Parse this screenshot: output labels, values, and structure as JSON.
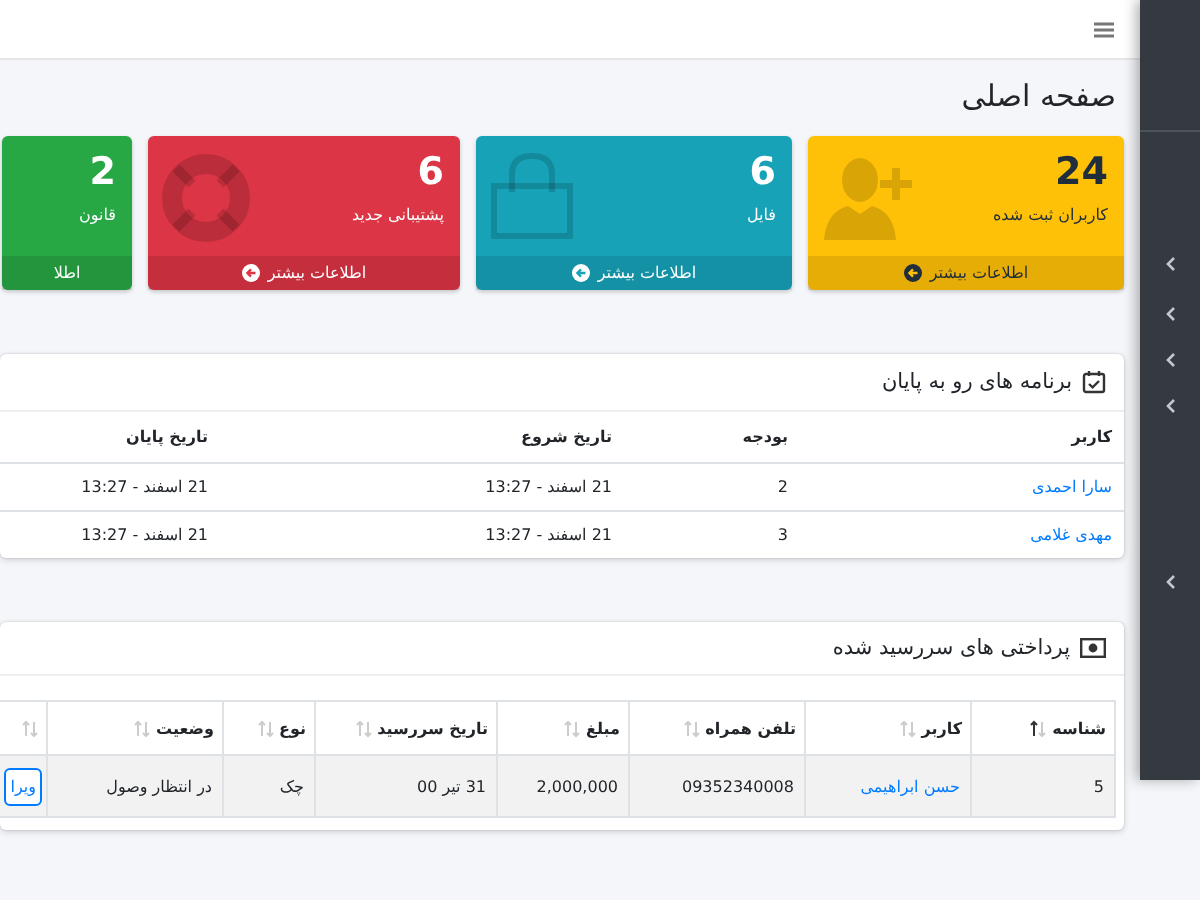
{
  "page_title": "صفحه اصلی",
  "stat_cards": [
    {
      "kind": "users",
      "color": "#ffc107",
      "value": "24",
      "label": "کاربران ثبت شده",
      "link": "اطلاعات بیشتر",
      "link_icon": true
    },
    {
      "kind": "files",
      "color": "#17a2b8",
      "value": "6",
      "label": "فایل",
      "link": "اطلاعات بیشتر",
      "link_icon": true
    },
    {
      "kind": "support",
      "color": "#dc3545",
      "value": "6",
      "label": "پشتیبانی جدید",
      "link": "اطلاعات بیشتر",
      "link_icon": true
    },
    {
      "kind": "rules",
      "color": "#28a745",
      "value": "2",
      "label": "قانون",
      "link": "اطلا",
      "link_icon": false
    }
  ],
  "ending_programs": {
    "title": "برنامه های رو به پایان",
    "columns": [
      "کاربر",
      "بودجه",
      "تاریخ شروع",
      "تاریخ پایان"
    ],
    "rows": [
      [
        "سارا احمدی",
        "2",
        "21 اسفند - 13:27",
        "21 اسفند - 13:27"
      ],
      [
        "مهدی غلامی",
        "3",
        "21 اسفند - 13:27",
        "21 اسفند - 13:27"
      ]
    ]
  },
  "due_payments": {
    "title": "پرداختی های سررسید شده",
    "columns": [
      {
        "label": "شناسه",
        "sorted": true
      },
      {
        "label": "کاربر",
        "sorted": false
      },
      {
        "label": "تلفن همراه",
        "sorted": false
      },
      {
        "label": "مبلغ",
        "sorted": false
      },
      {
        "label": "تاریخ سررسید",
        "sorted": false
      },
      {
        "label": "نوع",
        "sorted": false
      },
      {
        "label": "وضعیت",
        "sorted": false
      },
      {
        "sorted": false
      }
    ],
    "rows": [
      {
        "cells": [
          "5",
          "حسن ابراهیمی",
          "09352340008",
          "2,000,000",
          "31 تیر 00",
          "چک",
          "در انتظار وصول"
        ],
        "action": "ویرا",
        "highlighted": true
      }
    ]
  }
}
